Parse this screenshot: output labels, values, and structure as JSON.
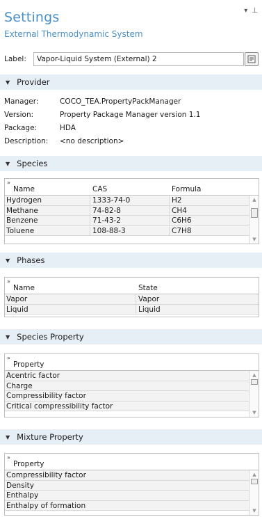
{
  "header": {
    "title": "Settings",
    "subtitle": "External Thermodynamic System",
    "dropdown_icon": "▾",
    "pin_icon": "⊥"
  },
  "label_field": {
    "label": "Label:",
    "value": "Vapor-Liquid System (External) 2"
  },
  "provider": {
    "title": "Provider",
    "rows": [
      {
        "key": "Manager:",
        "value": "COCO_TEA.PropertyPackManager"
      },
      {
        "key": "Version:",
        "value": "Property Package Manager version 1.1"
      },
      {
        "key": "Package:",
        "value": "HDA"
      },
      {
        "key": "Description:",
        "value": "<no description>"
      }
    ]
  },
  "species": {
    "title": "Species",
    "columns": [
      "Name",
      "CAS",
      "Formula"
    ],
    "rows": [
      [
        "Hydrogen",
        "1333-74-0",
        "H2"
      ],
      [
        "Methane",
        "74-82-8",
        "CH4"
      ],
      [
        "Benzene",
        "71-43-2",
        "C6H6"
      ],
      [
        "Toluene",
        "108-88-3",
        "C7H8"
      ]
    ]
  },
  "phases": {
    "title": "Phases",
    "columns": [
      "Name",
      "State"
    ],
    "rows": [
      [
        "Vapor",
        "Vapor"
      ],
      [
        "Liquid",
        "Liquid"
      ]
    ]
  },
  "species_property": {
    "title": "Species Property",
    "column": "Property",
    "rows": [
      "Acentric factor",
      "Charge",
      "Compressibility factor",
      "Critical compressibility factor"
    ]
  },
  "mixture_property": {
    "title": "Mixture Property",
    "column": "Property",
    "rows": [
      "Compressibility factor",
      "Density",
      "Enthalpy",
      "Enthalpy of formation"
    ]
  },
  "colors": {
    "accent": "#4a90c8",
    "section_bg": "#e6eef6",
    "border": "#bfbfbf"
  }
}
